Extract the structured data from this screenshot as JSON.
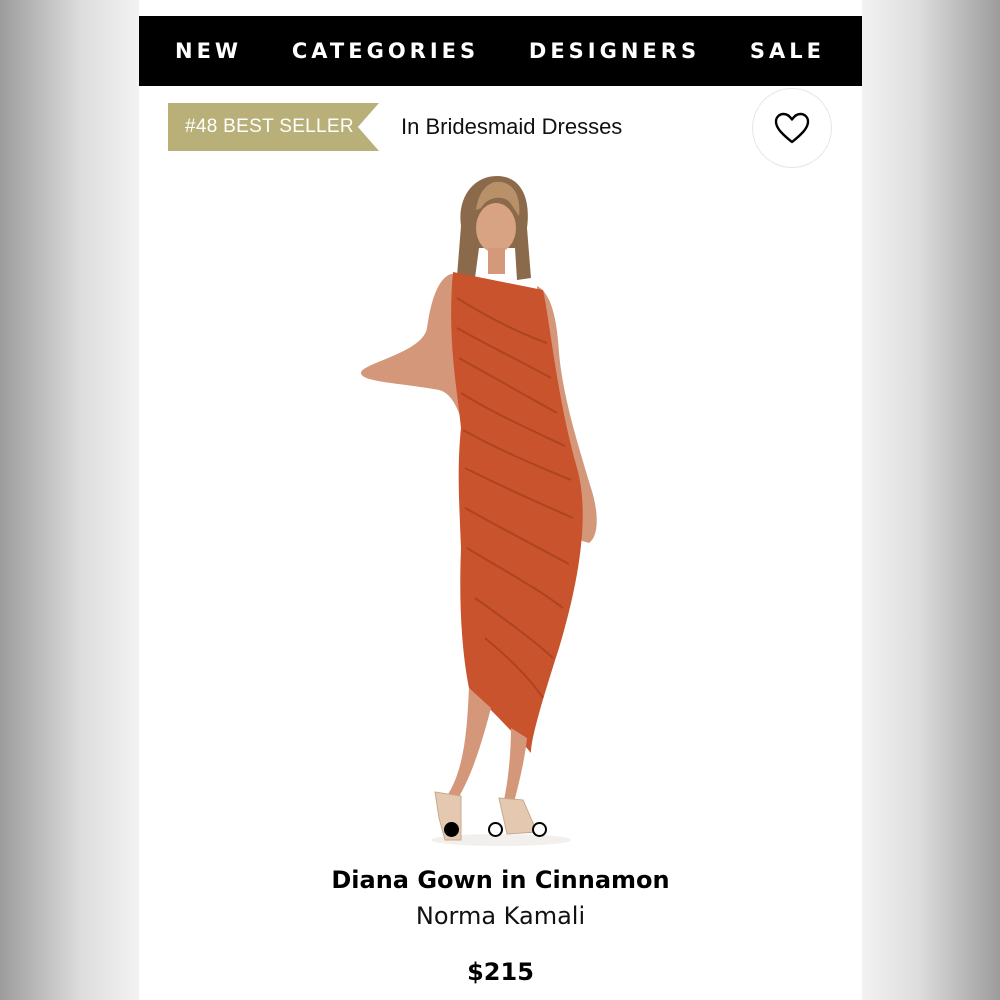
{
  "nav": {
    "items": [
      {
        "label": "NEW"
      },
      {
        "label": "CATEGORIES"
      },
      {
        "label": "DESIGNERS"
      },
      {
        "label": "SALE"
      }
    ]
  },
  "badge": {
    "ribbon_text": "#48 BEST SELLER",
    "category_text": "In Bridesmaid Dresses",
    "ribbon_color": "#b8b078"
  },
  "wishlist": {
    "icon": "heart-icon"
  },
  "gallery": {
    "image": "model-in-orange-one-shoulder-gown",
    "dot_count": 3,
    "active_index": 0
  },
  "product": {
    "name": "Diana Gown in Cinnamon",
    "brand": "Norma Kamali",
    "price": "$215",
    "dress_color": "#c8532d"
  }
}
